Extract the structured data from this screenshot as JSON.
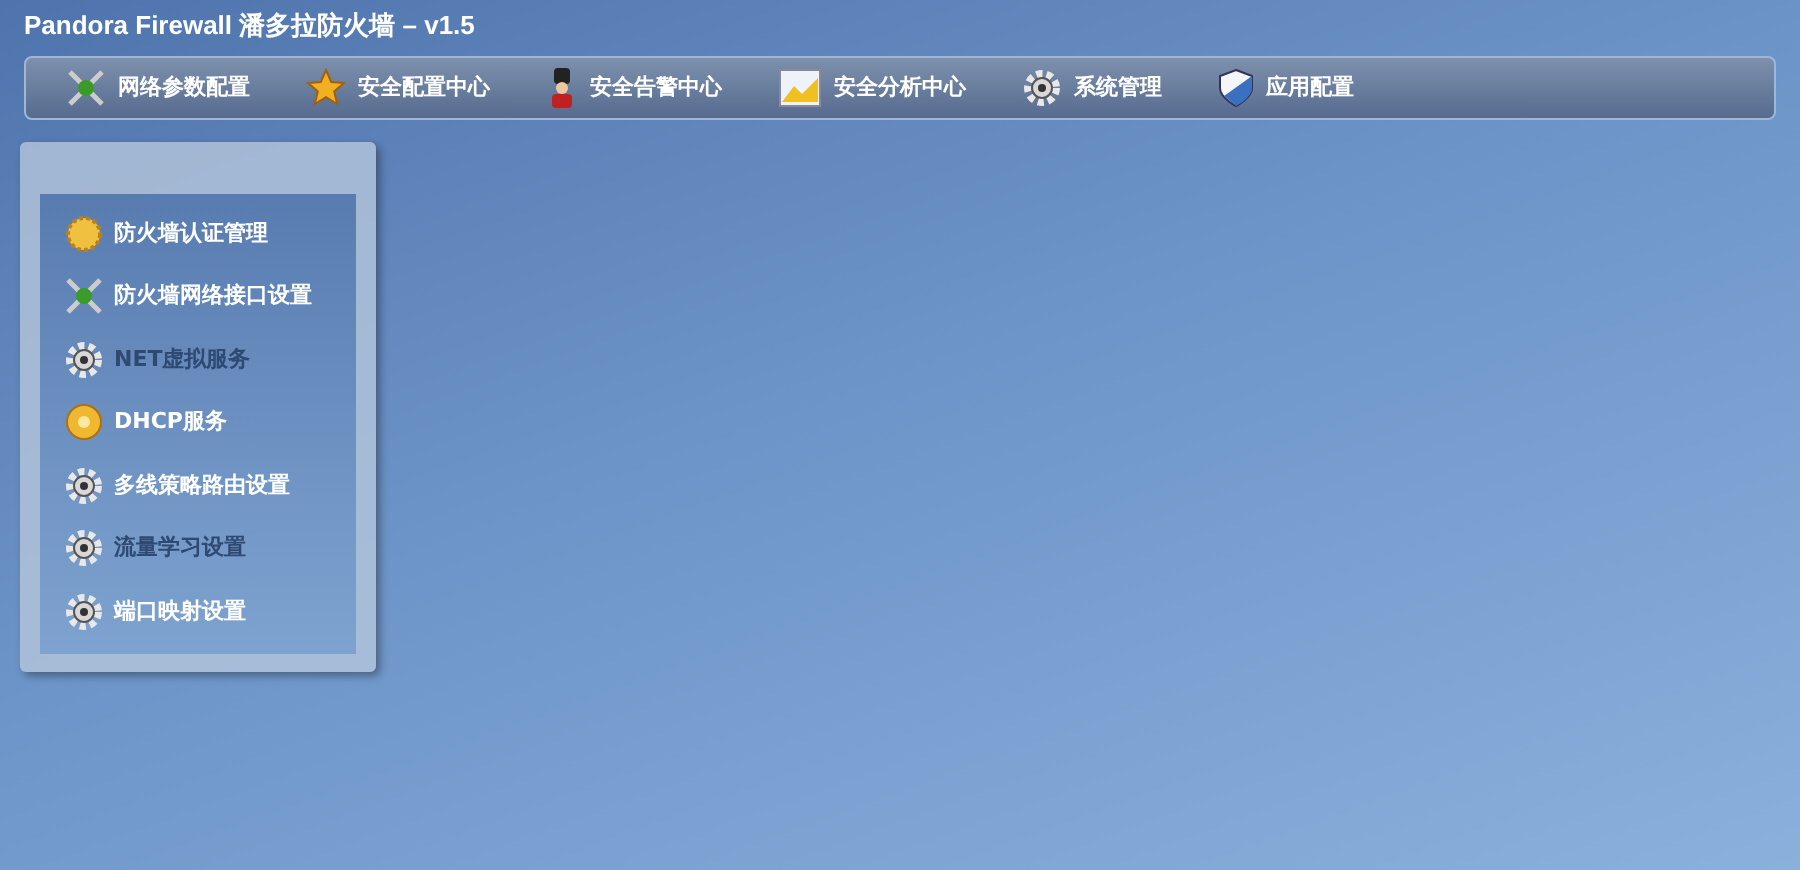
{
  "window": {
    "title": "Pandora Firewall 潘多拉防火墙 – v1.5"
  },
  "menu": [
    {
      "label": "网络参数配置",
      "kind": "network"
    },
    {
      "label": "安全配置中心",
      "kind": "star"
    },
    {
      "label": "安全告警中心",
      "kind": "guard"
    },
    {
      "label": "安全分析中心",
      "kind": "chart"
    },
    {
      "label": "系统管理",
      "kind": "gear"
    },
    {
      "label": "应用配置",
      "kind": "shield"
    }
  ],
  "sidebar": {
    "items": [
      {
        "label": "防火墙认证管理",
        "kind": "sun",
        "disabled": false
      },
      {
        "label": "防火墙网络接口设置",
        "kind": "network",
        "disabled": false
      },
      {
        "label": "NET虚拟服务",
        "kind": "gear",
        "disabled": true
      },
      {
        "label": "DHCP服务",
        "kind": "disc",
        "disabled": false
      },
      {
        "label": "多线策略路由设置",
        "kind": "gear",
        "disabled": false
      },
      {
        "label": "流量学习设置",
        "kind": "gear",
        "disabled": true
      },
      {
        "label": "端口映射设置",
        "kind": "gear",
        "disabled": false
      }
    ]
  }
}
